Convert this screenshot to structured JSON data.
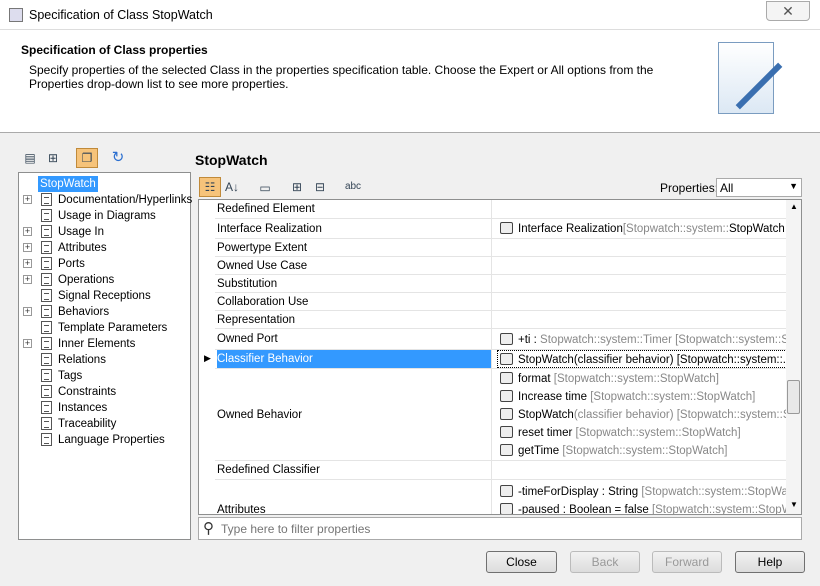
{
  "window": {
    "title": "Specification of Class StopWatch",
    "close_icon": "close-icon"
  },
  "header": {
    "title": "Specification of Class properties",
    "description": "Specify properties of the selected Class in the properties specification table. Choose the Expert or All options from the Properties drop-down list to see more properties."
  },
  "tree": {
    "items": [
      {
        "label": "StopWatch",
        "selected": true,
        "expandable": false
      },
      {
        "label": "Documentation/Hyperlinks",
        "expandable": true
      },
      {
        "label": "Usage in Diagrams",
        "expandable": false
      },
      {
        "label": "Usage In",
        "expandable": true
      },
      {
        "label": "Attributes",
        "expandable": true
      },
      {
        "label": "Ports",
        "expandable": true
      },
      {
        "label": "Operations",
        "expandable": true
      },
      {
        "label": "Signal Receptions",
        "expandable": false
      },
      {
        "label": "Behaviors",
        "expandable": true
      },
      {
        "label": "Template Parameters",
        "expandable": false
      },
      {
        "label": "Inner Elements",
        "expandable": true
      },
      {
        "label": "Relations",
        "expandable": false
      },
      {
        "label": "Tags",
        "expandable": false
      },
      {
        "label": "Constraints",
        "expandable": false
      },
      {
        "label": "Instances",
        "expandable": false
      },
      {
        "label": "Traceability",
        "expandable": false
      },
      {
        "label": "Language Properties",
        "expandable": false
      }
    ]
  },
  "main": {
    "title": "StopWatch",
    "properties_label": "Properties:",
    "properties_value": "All",
    "filter_placeholder": "Type here to filter properties",
    "rows": [
      {
        "name": "Redefined Element",
        "values": []
      },
      {
        "name": "Interface Realization",
        "values": [
          {
            "main": "Interface Realization",
            "gray": "[Stopwatch::system::",
            "tail": "StopWatch ->"
          }
        ]
      },
      {
        "name": "Powertype Extent",
        "values": []
      },
      {
        "name": "Owned Use Case",
        "values": []
      },
      {
        "name": "Substitution",
        "values": []
      },
      {
        "name": "Collaboration Use",
        "values": []
      },
      {
        "name": "Representation",
        "values": []
      },
      {
        "name": "Owned Port",
        "values": [
          {
            "main": "+ti :",
            "gray": " Stopwatch::system::Timer [Stopwatch::system::St",
            "tail": ""
          }
        ]
      },
      {
        "name": "Classifier Behavior",
        "selected": true,
        "values": [
          {
            "main": "StopWatch(classifier behavior) [Stopwatch::system::...",
            "gray": "",
            "tail": ""
          }
        ]
      },
      {
        "name": "Owned Behavior",
        "values": [
          {
            "main": "format",
            "gray": " [Stopwatch::system::StopWatch]",
            "tail": ""
          },
          {
            "main": "Increase time",
            "gray": " [Stopwatch::system::StopWatch]",
            "tail": ""
          },
          {
            "main": "StopWatch",
            "gray": "(classifier behavior) [Stopwatch::system::Sto",
            "tail": ""
          },
          {
            "main": "reset timer",
            "gray": " [Stopwatch::system::StopWatch]",
            "tail": ""
          },
          {
            "main": "getTime",
            "gray": " [Stopwatch::system::StopWatch]",
            "tail": ""
          }
        ]
      },
      {
        "name": "Redefined Classifier",
        "values": []
      },
      {
        "name": "Attributes",
        "values": [
          {
            "main": "-timeForDisplay : String",
            "gray": " [Stopwatch::system::StopWatch]",
            "tail": ""
          },
          {
            "main": "-paused : Boolean = false",
            "gray": " [Stopwatch::system::StopWa",
            "tail": ""
          }
        ]
      }
    ]
  },
  "buttons": {
    "close": "Close",
    "back": "Back",
    "forward": "Forward",
    "help": "Help"
  },
  "colors": {
    "selection": "#3399ff",
    "accent": "#f6c37a"
  }
}
